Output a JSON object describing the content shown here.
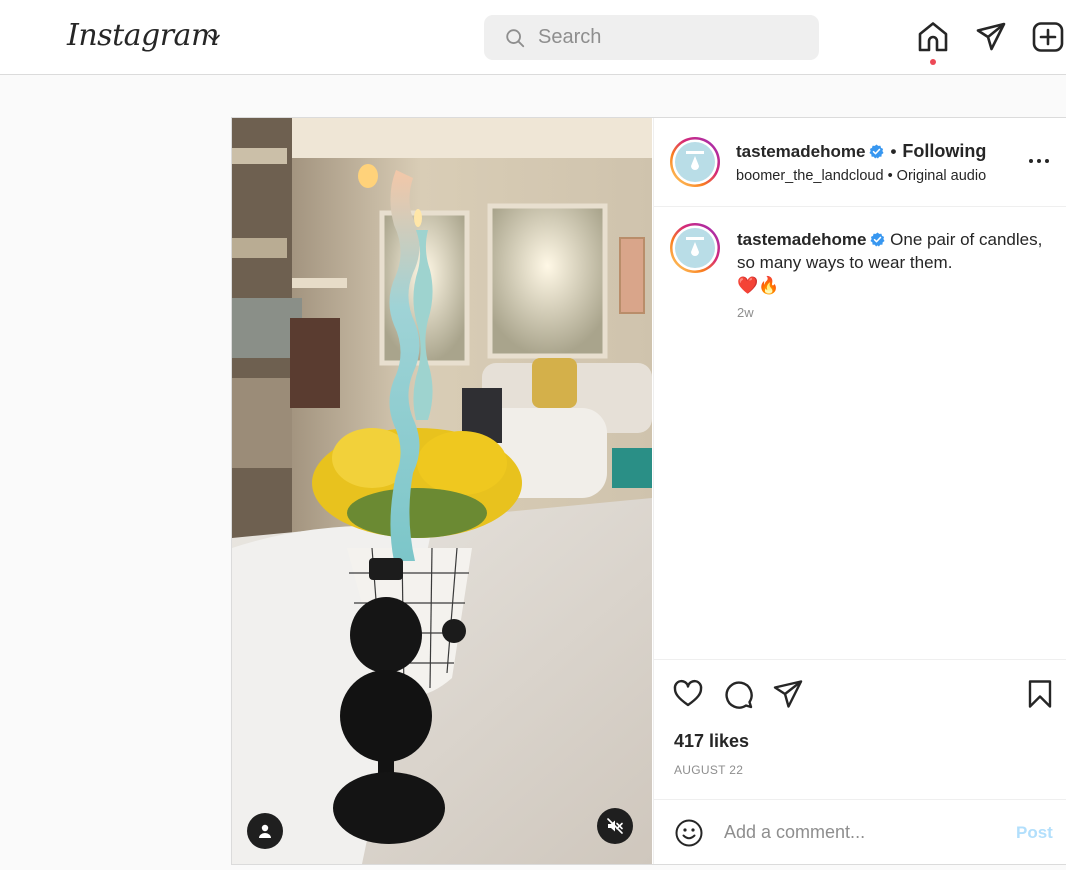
{
  "header": {
    "logo": "Instagram",
    "search_placeholder": "Search"
  },
  "post": {
    "author": {
      "username": "tastemadehome",
      "verified": true,
      "follow_status": "Following",
      "audio_artist": "boomer_the_landcloud",
      "audio_label": "Original audio"
    },
    "caption": {
      "username": "tastemadehome",
      "text": "One pair of candles, so many ways to wear them.",
      "emojis": "❤️🔥",
      "time": "2w"
    },
    "likes": "417 likes",
    "date": "AUGUST 22",
    "comment_placeholder": "Add a comment...",
    "post_button": "Post"
  },
  "colors": {
    "notification_dot": "#ed4956",
    "verified_badge": "#3897f0",
    "post_button_disabled": "#b2dffc"
  }
}
